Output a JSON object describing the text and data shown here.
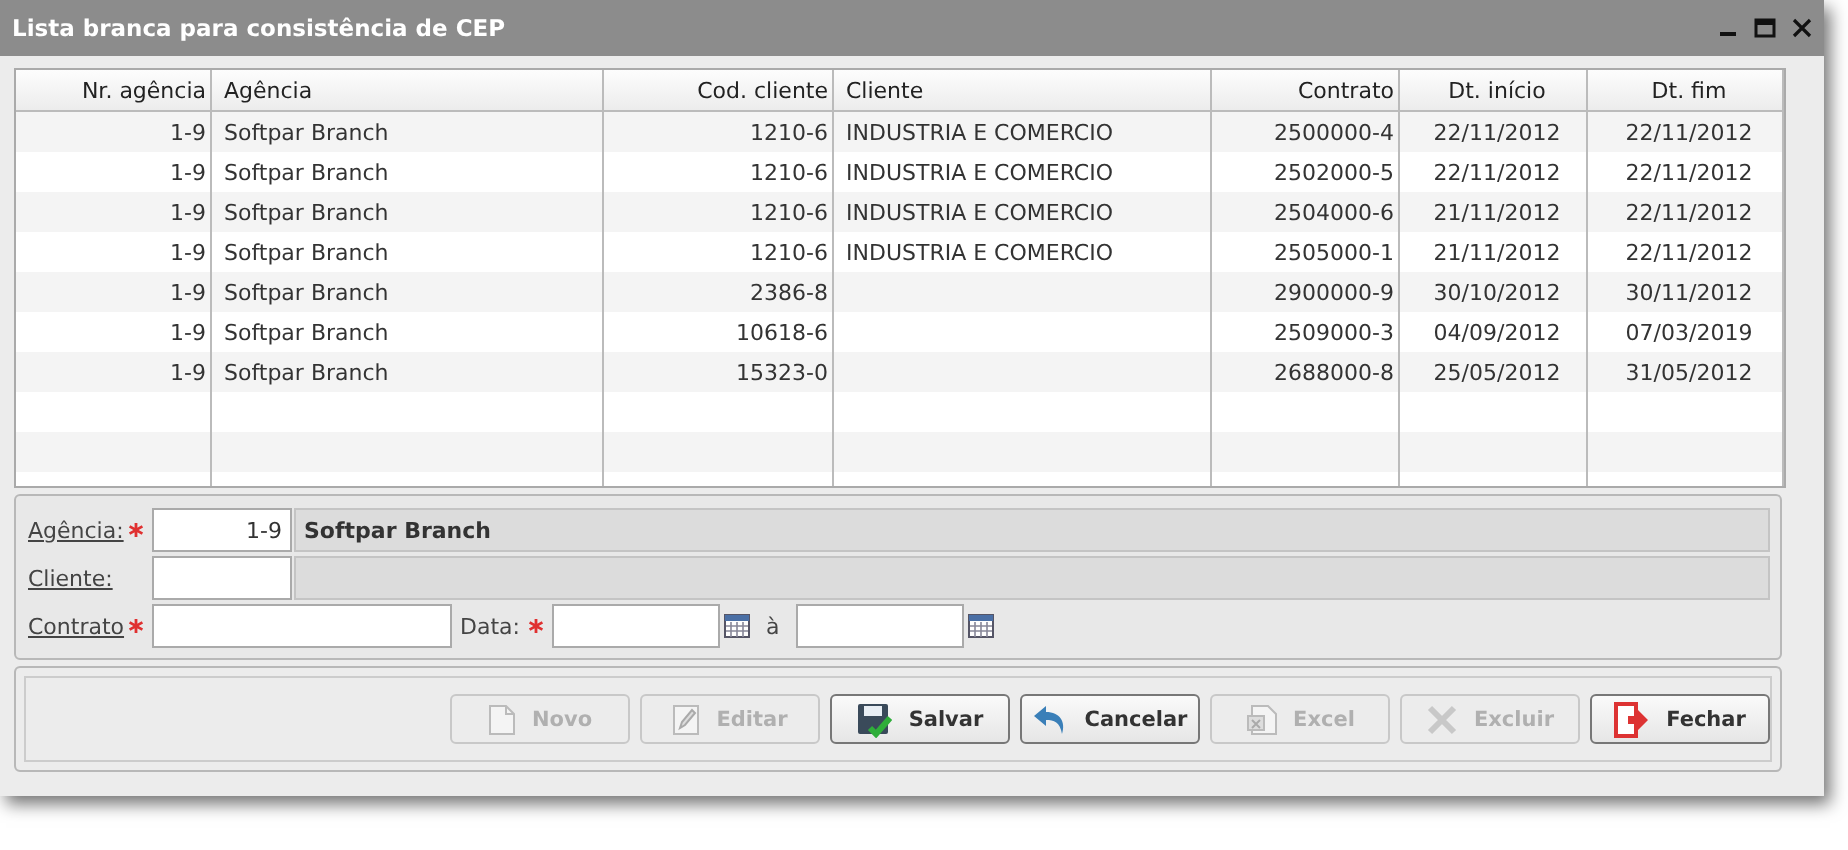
{
  "window": {
    "title": "Lista branca para consistência de CEP"
  },
  "table": {
    "columns": [
      "Nr. agência",
      "Agência",
      "Cod. cliente",
      "Cliente",
      "Contrato",
      "Dt. início",
      "Dt. fim"
    ],
    "rows": [
      [
        "1-9",
        "Softpar Branch",
        "1210-6",
        "INDUSTRIA E COMERCIO",
        "2500000-4",
        "22/11/2012",
        "22/11/2012"
      ],
      [
        "1-9",
        "Softpar Branch",
        "1210-6",
        "INDUSTRIA E COMERCIO",
        "2502000-5",
        "22/11/2012",
        "22/11/2012"
      ],
      [
        "1-9",
        "Softpar Branch",
        "1210-6",
        "INDUSTRIA E COMERCIO",
        "2504000-6",
        "21/11/2012",
        "22/11/2012"
      ],
      [
        "1-9",
        "Softpar Branch",
        "1210-6",
        "INDUSTRIA E COMERCIO",
        "2505000-1",
        "21/11/2012",
        "22/11/2012"
      ],
      [
        "1-9",
        "Softpar Branch",
        "2386-8",
        "",
        "2900000-9",
        "30/10/2012",
        "30/11/2012"
      ],
      [
        "1-9",
        "Softpar Branch",
        "10618-6",
        "",
        "2509000-3",
        "04/09/2012",
        "07/03/2019"
      ],
      [
        "1-9",
        "Softpar Branch",
        "15323-0",
        "",
        "2688000-8",
        "25/05/2012",
        "31/05/2012"
      ]
    ]
  },
  "form": {
    "agencia": {
      "label": "Agência:",
      "required": true,
      "code": "1-9",
      "name": "Softpar Branch"
    },
    "cliente": {
      "label": "Cliente:",
      "required": false
    },
    "contrato": {
      "label": "Contrato",
      "required": true
    },
    "data": {
      "label": "Data:",
      "required": true,
      "separator": "à"
    }
  },
  "buttons": [
    {
      "kind": "new",
      "label": "Novo",
      "disabled": true
    },
    {
      "kind": "edit",
      "label": "Editar",
      "disabled": true
    },
    {
      "kind": "save",
      "label": "Salvar",
      "disabled": false
    },
    {
      "kind": "cancel",
      "label": "Cancelar",
      "disabled": false
    },
    {
      "kind": "excel",
      "label": "Excel",
      "disabled": true
    },
    {
      "kind": "delete",
      "label": "Excluir",
      "disabled": true
    },
    {
      "kind": "close",
      "label": "Fechar",
      "disabled": false
    }
  ]
}
